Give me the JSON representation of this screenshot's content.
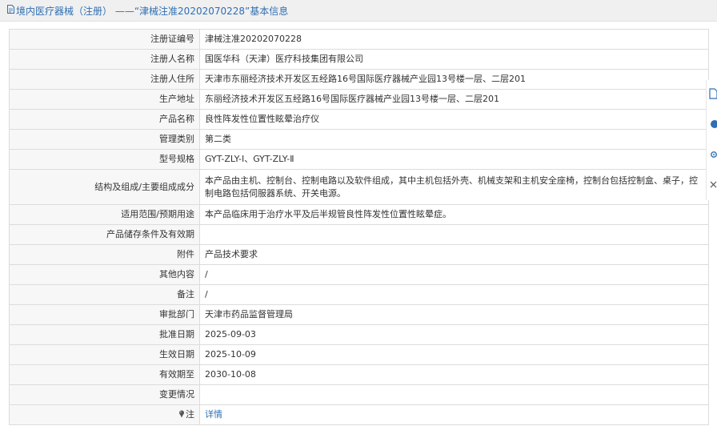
{
  "header": {
    "breadcrumb": "境内医疗器械（注册）",
    "separator": " ——“津械注准20202070228”基本信息"
  },
  "rows": [
    {
      "label": "注册证编号",
      "value": "津械注准20202070228"
    },
    {
      "label": "注册人名称",
      "value": "国医华科（天津）医疗科技集团有限公司"
    },
    {
      "label": "注册人住所",
      "value": "天津市东丽经济技术开发区五经路16号国际医疗器械产业园13号楼一层、二层201"
    },
    {
      "label": "生产地址",
      "value": "东丽经济技术开发区五经路16号国际医疗器械产业园13号楼一层、二层201"
    },
    {
      "label": "产品名称",
      "value": "良性阵发性位置性眩晕治疗仪"
    },
    {
      "label": "管理类别",
      "value": "第二类"
    },
    {
      "label": "型号规格",
      "value": "GYT-ZLY-Ⅰ、GYT-ZLY-Ⅱ"
    },
    {
      "label": "结构及组成/主要组成成分",
      "value": "本产品由主机、控制台、控制电路以及软件组成，其中主机包括外壳、机械支架和主机安全座椅，控制台包括控制盒、桌子，控制电路包括伺服器系统、开关电源。"
    },
    {
      "label": "适用范围/预期用途",
      "value": "本产品临床用于治疗水平及后半规管良性阵发性位置性眩晕症。"
    },
    {
      "label": "产品储存条件及有效期",
      "value": ""
    },
    {
      "label": "附件",
      "value": "产品技术要求"
    },
    {
      "label": "其他内容",
      "value": "/"
    },
    {
      "label": "备注",
      "value": "/"
    },
    {
      "label": "审批部门",
      "value": "天津市药品监督管理局"
    },
    {
      "label": "批准日期",
      "value": "2025-09-03"
    },
    {
      "label": "生效日期",
      "value": "2025-10-09"
    },
    {
      "label": "有效期至",
      "value": "2030-10-08"
    },
    {
      "label": "变更情况",
      "value": ""
    }
  ],
  "note_row": {
    "label": "注",
    "link": "详情"
  },
  "icons": {
    "header": "document-icon",
    "note": "pin-icon",
    "side": [
      "document-icon",
      "info-icon",
      "settings-icon",
      "close-icon"
    ]
  },
  "colors": {
    "link": "#2f6fb3",
    "label_bg": "#f7f7f7",
    "border": "#dcdcdc",
    "header_bg": "#f0f0f0"
  }
}
